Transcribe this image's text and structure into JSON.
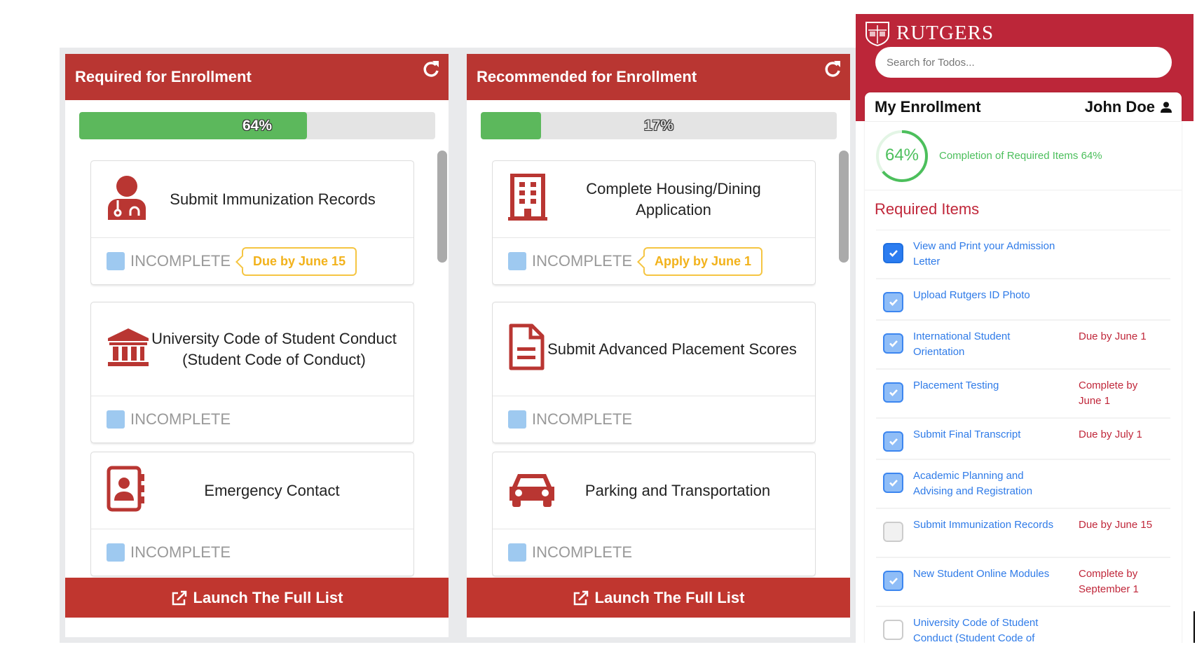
{
  "required_panel": {
    "title": "Required for Enrollment",
    "progress_percent": 64,
    "progress_label": "64%",
    "launch_label": "Launch The Full List",
    "cards": [
      {
        "title": "Submit Immunization Records",
        "icon": "doctor-icon",
        "status": "INCOMPLETE",
        "due": "Due by June 15"
      },
      {
        "title": "University Code of Student Conduct (Student Code of Conduct)",
        "icon": "university-icon",
        "status": "INCOMPLETE",
        "due": ""
      },
      {
        "title": "Emergency Contact",
        "icon": "address-book-icon",
        "status": "INCOMPLETE",
        "due": ""
      }
    ]
  },
  "recommended_panel": {
    "title": "Recommended for Enrollment",
    "progress_percent": 17,
    "progress_label": "17%",
    "launch_label": "Launch The Full List",
    "cards": [
      {
        "title": "Complete Housing/Dining Application",
        "icon": "building-icon",
        "status": "INCOMPLETE",
        "due": "Apply by June 1"
      },
      {
        "title": "Submit Advanced Placement Scores",
        "icon": "file-icon",
        "status": "INCOMPLETE",
        "due": ""
      },
      {
        "title": "Parking and Transportation",
        "icon": "car-icon",
        "status": "INCOMPLETE",
        "due": ""
      }
    ]
  },
  "sidebar": {
    "brand": "RUTGERS",
    "search_placeholder": "Search for Todos...",
    "section_title": "My Enrollment",
    "user_name": "John Doe",
    "completion_percent": 64,
    "completion_label": "64%",
    "completion_text": "Completion of Required Items 64%",
    "required_heading": "Required Items",
    "items": [
      {
        "label": "View and Print your Admission Letter",
        "due": "",
        "checked": true
      },
      {
        "label": "Upload Rutgers ID Photo",
        "due": "",
        "checked": true
      },
      {
        "label": "International Student Orientation",
        "due": "Due by June 1",
        "checked": true
      },
      {
        "label": "Placement Testing",
        "due": "Complete by June 1",
        "checked": true
      },
      {
        "label": "Submit Final Transcript",
        "due": "Due by July 1",
        "checked": true
      },
      {
        "label": "Academic Planning and Advising and Registration",
        "due": "",
        "checked": true
      },
      {
        "label": "Submit Immunization Records",
        "due": "Due by June 15",
        "checked": false
      },
      {
        "label": "New Student Online Modules",
        "due": "Complete by September 1",
        "checked": true
      },
      {
        "label": "University Code of Student Conduct (Student Code of Conduct)",
        "due": "",
        "checked": false
      }
    ]
  },
  "colors": {
    "header_red": "#b93632",
    "brand_red": "#bc2639",
    "progress_green": "#5cb85c",
    "link_blue": "#2f7be8",
    "due_yellow": "#f2b21b"
  }
}
